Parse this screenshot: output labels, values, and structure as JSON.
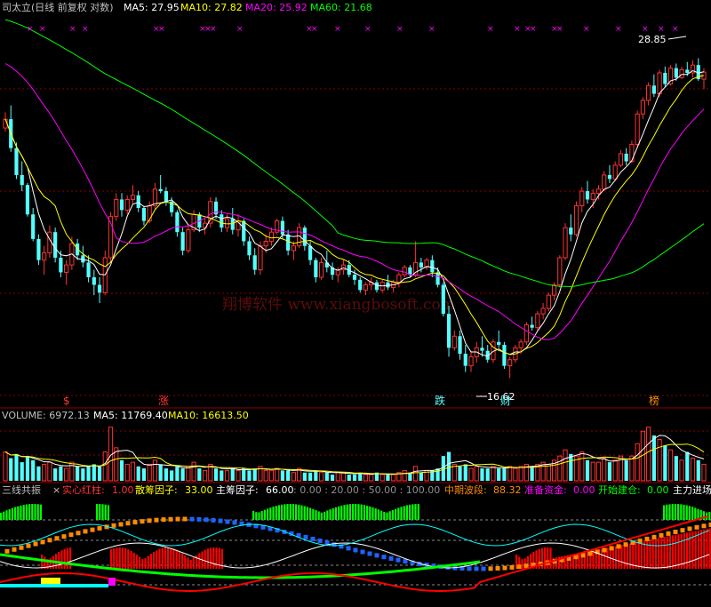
{
  "colors": {
    "up": "#ff3232",
    "down": "#54ffff",
    "ma5": "#ffffff",
    "ma10": "#ffff00",
    "ma20": "#ff00ff",
    "ma60": "#00ff00",
    "grid": "#8b0000",
    "white": "#ffffff",
    "yellow": "#ffff00",
    "magenta": "#ff00ff",
    "green": "#00ff00",
    "orange": "#ff8c00",
    "blue": "#1e64ff",
    "red": "#ff0000",
    "cyan": "#00ffff"
  },
  "header": {
    "name": "司太立(日线 前复权 对数)",
    "ma5": "MA5: 27.95",
    "ma10": "MA10: 27.82",
    "ma20": "MA20: 25.92",
    "ma60": "MA60: 21.68"
  },
  "volume_header": {
    "vol": "VOLUME: 6972.13",
    "ma5": "MA5: 11769.40",
    "ma10": "MA10: 16613.50"
  },
  "indicator_header": {
    "name": "三线共振",
    "close_icon": "close-icon",
    "solid_red_label": "实心红柱:",
    "solid_red_val": "1.00",
    "scatter_label": "散筹因子:",
    "scatter_val": "33.00",
    "main_label": "主筹因子:",
    "main_val": "66.00",
    "levels": ": 0.00 : 20.00 : 50.00 : 100.00",
    "mid_label": "中期波段:",
    "mid_val": "88.32",
    "prep_label": "准备资金:",
    "prep_val": "0.00",
    "start_label": "开始建仓:",
    "start_val": "0.00",
    "trail": "主力进场"
  },
  "annotations": {
    "high": "28.85",
    "low": "16.62",
    "watermark": "翔博软件 www.xiangbosoft.com"
  },
  "markers": [
    "$",
    "涨",
    "跌",
    "财",
    "榜"
  ],
  "chart_data": {
    "type": "candlestick",
    "ohlc": [
      [
        24.6,
        25.5,
        24.4,
        25.1
      ],
      [
        25.1,
        25.9,
        23.3,
        23.5
      ],
      [
        23.5,
        23.8,
        21.9,
        22.1
      ],
      [
        22.1,
        22.8,
        21.3,
        21.6
      ],
      [
        21.6,
        21.7,
        20.1,
        20.2
      ],
      [
        20.2,
        20.5,
        19.0,
        19.1
      ],
      [
        19.1,
        19.3,
        18.0,
        18.2
      ],
      [
        18.2,
        18.8,
        17.6,
        18.5
      ],
      [
        18.5,
        19.7,
        18.3,
        19.4
      ],
      [
        19.4,
        19.6,
        18.1,
        18.3
      ],
      [
        18.3,
        18.6,
        17.5,
        17.7
      ],
      [
        17.7,
        18.2,
        17.2,
        18.0
      ],
      [
        18.0,
        19.2,
        17.8,
        18.9
      ],
      [
        18.9,
        19.1,
        18.2,
        18.4
      ],
      [
        18.4,
        18.8,
        17.9,
        18.1
      ],
      [
        18.1,
        18.4,
        17.3,
        17.5
      ],
      [
        17.5,
        17.8,
        16.8,
        17.2
      ],
      [
        17.2,
        17.5,
        16.5,
        16.9
      ],
      [
        16.9,
        18.6,
        16.8,
        18.3
      ],
      [
        18.3,
        20.3,
        18.1,
        20.1
      ],
      [
        20.1,
        21.2,
        19.9,
        20.9
      ],
      [
        20.9,
        21.2,
        20.1,
        20.4
      ],
      [
        20.4,
        21.1,
        20.2,
        20.9
      ],
      [
        20.9,
        21.6,
        20.7,
        21.1
      ],
      [
        21.1,
        21.3,
        20.3,
        20.5
      ],
      [
        20.5,
        20.6,
        19.7,
        19.9
      ],
      [
        19.9,
        20.8,
        19.8,
        20.6
      ],
      [
        20.6,
        21.7,
        20.4,
        21.4
      ],
      [
        21.4,
        22.1,
        21.2,
        21.3
      ],
      [
        21.3,
        21.5,
        20.6,
        20.8
      ],
      [
        20.8,
        21.0,
        20.1,
        20.3
      ],
      [
        20.3,
        20.4,
        19.2,
        19.4
      ],
      [
        19.4,
        19.6,
        18.4,
        18.6
      ],
      [
        18.6,
        19.7,
        18.5,
        19.5
      ],
      [
        19.5,
        20.4,
        19.4,
        20.2
      ],
      [
        20.2,
        20.3,
        19.4,
        19.6
      ],
      [
        19.6,
        20.0,
        19.3,
        19.8
      ],
      [
        19.8,
        21.0,
        19.6,
        20.8
      ],
      [
        20.8,
        21.0,
        20.0,
        20.2
      ],
      [
        20.2,
        20.4,
        19.4,
        19.6
      ],
      [
        19.6,
        20.2,
        19.4,
        20.0
      ],
      [
        20.0,
        20.5,
        19.3,
        19.5
      ],
      [
        19.5,
        20.2,
        19.2,
        19.9
      ],
      [
        19.9,
        20.0,
        18.8,
        19.0
      ],
      [
        19.0,
        19.2,
        18.2,
        18.4
      ],
      [
        18.4,
        18.7,
        17.6,
        17.8
      ],
      [
        17.8,
        19.0,
        17.6,
        18.8
      ],
      [
        18.8,
        19.3,
        18.5,
        19.0
      ],
      [
        19.0,
        19.6,
        18.8,
        19.4
      ],
      [
        19.4,
        20.0,
        19.3,
        19.9
      ],
      [
        19.9,
        20.1,
        19.1,
        19.3
      ],
      [
        19.3,
        19.5,
        18.4,
        18.6
      ],
      [
        18.6,
        19.0,
        18.2,
        18.8
      ],
      [
        18.8,
        19.8,
        18.7,
        19.6
      ],
      [
        19.6,
        19.7,
        18.6,
        18.8
      ],
      [
        18.8,
        19.0,
        18.0,
        18.2
      ],
      [
        18.2,
        18.3,
        17.3,
        17.5
      ],
      [
        17.5,
        18.3,
        17.4,
        18.1
      ],
      [
        18.1,
        18.6,
        17.7,
        17.9
      ],
      [
        17.9,
        18.1,
        17.4,
        17.6
      ],
      [
        17.6,
        17.9,
        17.3,
        17.8
      ],
      [
        17.8,
        18.2,
        17.6,
        18.0
      ],
      [
        18.0,
        18.2,
        17.5,
        17.6
      ],
      [
        17.6,
        17.8,
        17.2,
        17.4
      ],
      [
        17.4,
        17.5,
        16.9,
        17.0
      ],
      [
        17.0,
        17.3,
        16.8,
        17.2
      ],
      [
        17.2,
        17.5,
        17.0,
        17.3
      ],
      [
        17.3,
        17.4,
        16.9,
        17.0
      ],
      [
        17.0,
        17.4,
        16.9,
        17.3
      ],
      [
        17.3,
        17.6,
        17.0,
        17.1
      ],
      [
        17.1,
        17.4,
        16.9,
        17.3
      ],
      [
        17.3,
        17.7,
        17.1,
        17.6
      ],
      [
        17.6,
        18.0,
        17.5,
        17.9
      ],
      [
        17.9,
        18.0,
        17.5,
        17.6
      ],
      [
        17.6,
        19.0,
        17.5,
        18.1
      ],
      [
        18.1,
        18.3,
        17.7,
        17.9
      ],
      [
        17.9,
        18.3,
        17.8,
        18.2
      ],
      [
        18.2,
        18.4,
        17.5,
        17.7
      ],
      [
        17.7,
        17.9,
        17.1,
        17.2
      ],
      [
        17.2,
        17.3,
        16.0,
        16.1
      ],
      [
        16.1,
        16.4,
        14.6,
        14.9
      ],
      [
        14.9,
        15.5,
        14.8,
        15.3
      ],
      [
        15.3,
        15.5,
        14.5,
        14.7
      ],
      [
        14.7,
        15.0,
        14.1,
        14.3
      ],
      [
        14.3,
        14.8,
        14.1,
        14.6
      ],
      [
        14.6,
        15.1,
        14.4,
        14.9
      ],
      [
        14.9,
        15.3,
        14.6,
        14.8
      ],
      [
        14.8,
        15.0,
        14.4,
        14.5
      ],
      [
        14.5,
        15.2,
        14.4,
        15.1
      ],
      [
        15.1,
        15.5,
        14.9,
        15.0
      ],
      [
        15.0,
        15.1,
        14.2,
        14.3
      ],
      [
        14.3,
        14.6,
        13.9,
        14.5
      ],
      [
        14.5,
        15.0,
        14.4,
        14.9
      ],
      [
        14.9,
        15.2,
        14.7,
        15.1
      ],
      [
        15.1,
        15.8,
        15.0,
        15.7
      ],
      [
        15.7,
        16.0,
        15.5,
        15.6
      ],
      [
        15.6,
        16.2,
        15.5,
        16.1
      ],
      [
        16.1,
        16.5,
        15.9,
        16.3
      ],
      [
        16.3,
        16.9,
        16.2,
        16.8
      ],
      [
        16.8,
        17.3,
        16.6,
        17.2
      ],
      [
        17.2,
        18.4,
        17.1,
        18.3
      ],
      [
        18.3,
        19.8,
        18.2,
        19.6
      ],
      [
        19.6,
        20.2,
        19.0,
        19.3
      ],
      [
        19.3,
        20.8,
        19.2,
        20.6
      ],
      [
        20.6,
        21.5,
        20.3,
        21.3
      ],
      [
        21.3,
        21.8,
        20.7,
        20.9
      ],
      [
        20.9,
        21.4,
        20.5,
        21.2
      ],
      [
        21.2,
        21.6,
        20.9,
        21.4
      ],
      [
        21.4,
        22.3,
        21.3,
        22.1
      ],
      [
        22.1,
        22.6,
        21.7,
        21.9
      ],
      [
        21.9,
        22.8,
        21.8,
        22.6
      ],
      [
        22.6,
        23.4,
        22.5,
        23.2
      ],
      [
        23.2,
        23.5,
        22.6,
        22.8
      ],
      [
        22.8,
        23.9,
        22.7,
        23.7
      ],
      [
        23.7,
        25.6,
        23.6,
        25.4
      ],
      [
        25.4,
        26.4,
        25.1,
        26.2
      ],
      [
        26.2,
        27.3,
        25.9,
        27.1
      ],
      [
        27.1,
        27.8,
        26.4,
        26.6
      ],
      [
        26.6,
        28.1,
        26.4,
        27.9
      ],
      [
        27.9,
        28.3,
        27.0,
        27.2
      ],
      [
        27.2,
        28.4,
        27.1,
        28.2
      ],
      [
        28.2,
        28.5,
        27.4,
        27.6
      ],
      [
        27.6,
        28.3,
        27.5,
        28.1
      ],
      [
        28.1,
        28.6,
        27.7,
        27.9
      ],
      [
        27.9,
        28.7,
        27.6,
        28.4
      ],
      [
        28.4,
        28.85,
        27.4,
        27.5
      ],
      [
        27.5,
        28.2,
        26.9,
        27.95
      ]
    ],
    "volume": [
      14,
      11,
      13,
      9,
      12,
      10,
      7,
      8,
      9,
      6,
      7,
      6,
      9,
      7,
      6,
      7,
      8,
      7,
      14,
      26,
      16,
      10,
      8,
      9,
      7,
      6,
      8,
      10,
      8,
      6,
      5,
      7,
      6,
      7,
      9,
      6,
      5,
      8,
      6,
      5,
      5,
      6,
      5,
      6,
      5,
      6,
      7,
      5,
      5,
      6,
      5,
      5,
      4,
      6,
      4,
      4,
      5,
      4,
      4,
      3,
      4,
      4,
      3,
      3,
      4,
      3,
      3,
      4,
      3,
      3,
      3,
      4,
      5,
      4,
      7,
      4,
      5,
      5,
      6,
      12,
      14,
      8,
      7,
      8,
      6,
      7,
      6,
      6,
      7,
      6,
      6,
      7,
      6,
      7,
      8,
      7,
      8,
      9,
      8,
      10,
      12,
      15,
      13,
      12,
      14,
      10,
      9,
      9,
      11,
      9,
      10,
      12,
      10,
      12,
      18,
      24,
      26,
      22,
      20,
      17,
      15,
      12,
      10,
      14,
      11,
      10,
      8
    ],
    "ylim": [
      13.5,
      31
    ],
    "scale": "log",
    "indicator_series": [
      "实心红柱",
      "散筹因子",
      "主筹因子",
      "中期波段",
      "准备资金",
      "开始建仓"
    ]
  }
}
